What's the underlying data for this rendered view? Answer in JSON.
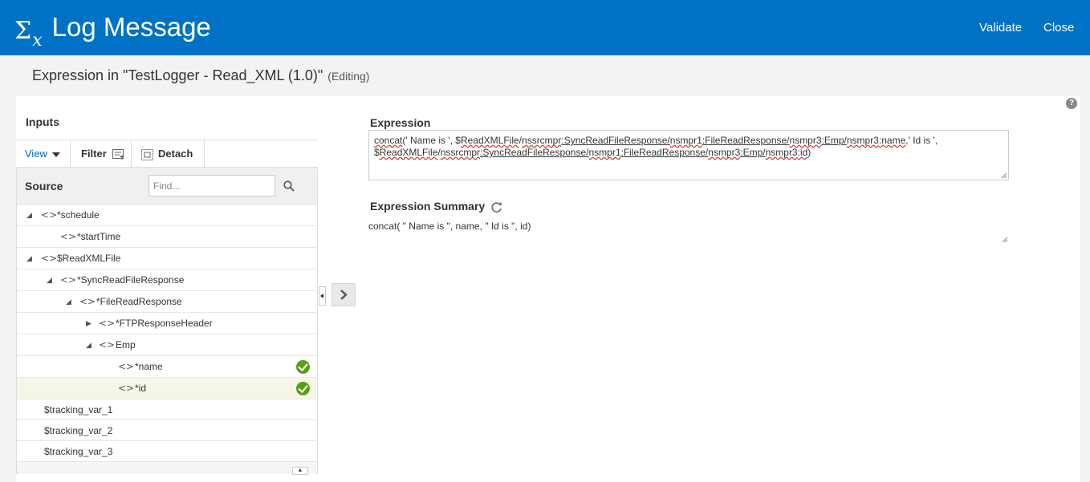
{
  "header": {
    "sigma": "Σ",
    "sigma_sub": "x",
    "title": "Log Message",
    "validate_label": "Validate",
    "close_label": "Close",
    "bg_color": "#0072c6"
  },
  "subheader": {
    "text": "Expression in \"TestLogger - Read_XML (1.0)\"",
    "state": "(Editing)"
  },
  "help": {
    "label": "?"
  },
  "inputs": {
    "title": "Inputs",
    "toolbar": {
      "view_label": "View",
      "filter_label": "Filter",
      "detach_label": "Detach"
    },
    "source_label": "Source",
    "find_placeholder": "Find...",
    "tree": [
      {
        "label": "*schedule",
        "twisty": "◢"
      },
      {
        "label": "*startTime",
        "twisty": ""
      },
      {
        "label": "$ReadXMLFile",
        "twisty": "◢"
      },
      {
        "label": "*SyncReadFileResponse",
        "twisty": "◢"
      },
      {
        "label": "*FileReadResponse",
        "twisty": "◢"
      },
      {
        "label": "*FTPResponseHeader",
        "twisty": "▶"
      },
      {
        "label": "Emp",
        "twisty": "◢"
      },
      {
        "label": "*name",
        "twisty": ""
      },
      {
        "label": "*id",
        "twisty": ""
      },
      {
        "label": "$tracking_var_1",
        "twisty": ""
      },
      {
        "label": "$tracking_var_2",
        "twisty": ""
      },
      {
        "label": "$tracking_var_3",
        "twisty": ""
      }
    ],
    "tag_glyph": "<>"
  },
  "expression": {
    "label": "Expression",
    "line1": {
      "p1": "concat",
      "p2": "(' Name is ', $",
      "p3": "ReadXMLFile",
      "p4": "/",
      "p5": "nssrcmpr",
      "p6": ":SyncReadFileResponse/",
      "p7": "nsmpr1",
      "p8": ":FileReadResponse/",
      "p9": "nsmpr3",
      "p10": ":Emp/",
      "p11": "nsmpr3",
      "p12": ":name",
      "p13": ",' Id is ',"
    },
    "line2": {
      "p1": "$",
      "p2": "ReadXMLFile",
      "p3": "/",
      "p4": "nssrcmpr",
      "p5": ":SyncReadFileResponse/",
      "p6": "nsmpr1",
      "p7": ":FileReadResponse/",
      "p8": "nsmpr3",
      "p9": ":Emp/",
      "p10": "nsmpr3",
      "p11": ":id",
      "p12": ")"
    }
  },
  "summary": {
    "label": "Expression Summary",
    "text": "concat( \" Name is \", name, \" Id is \", id)"
  }
}
